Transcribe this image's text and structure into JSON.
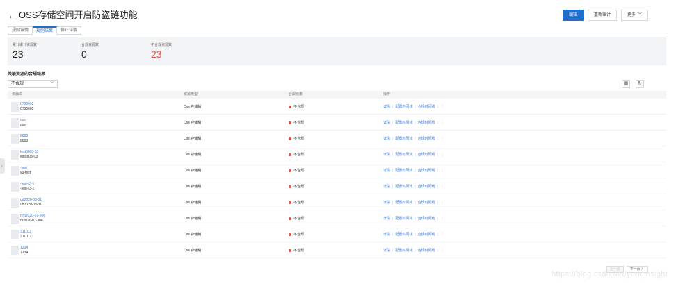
{
  "header": {
    "back_glyph": "←",
    "title": "OSS存储空间开启防盗链功能"
  },
  "actions": {
    "primary": "编辑",
    "recheck": "重新审计",
    "more": "更多",
    "more_chevron": "﹀"
  },
  "tabs": [
    {
      "label": "规则详情"
    },
    {
      "label": "规则结果"
    },
    {
      "label": "修正详情"
    }
  ],
  "summary": {
    "items": [
      {
        "label": "累计审计资源数",
        "value": "23"
      },
      {
        "label": "合规资源数",
        "value": "0"
      },
      {
        "label": "不合规资源数",
        "value": "23"
      }
    ],
    "noncompliant_color": "#e0504a"
  },
  "section_title": "关联资源的合规结果",
  "filter": {
    "value": "不合规",
    "arrow": "﹀"
  },
  "toolbar": {
    "grid_icon": "▦",
    "refresh_icon": "↻"
  },
  "table": {
    "headers": [
      "资源ID",
      "资源类型",
      "合规结果",
      "操作"
    ],
    "rows": [
      {
        "link": "0730603",
        "sub": "0730603",
        "type": "Oss 存储桶",
        "status": "不合规"
      },
      {
        "link": "oss-",
        "sub": "oss-",
        "type": "Oss 存储桶",
        "status": "不合规"
      },
      {
        "link": "8888",
        "sub": "8888",
        "type": "Oss 存储桶",
        "status": "不合规"
      },
      {
        "link": "test0803-03",
        "sub": "est0803-03",
        "type": "Oss 存储桶",
        "status": "不合规"
      },
      {
        "link": "-test",
        "sub": "yu-test",
        "type": "Oss 存储桶",
        "status": "不合规"
      },
      {
        "link": "-test-r3-1",
        "sub": "-test-r3-1",
        "type": "Oss 存储桶",
        "status": "不合规"
      },
      {
        "link": "ud2020-08-31",
        "sub": "ud2020-08-31",
        "type": "Oss 存储桶",
        "status": "不合规"
      },
      {
        "link": "rrrd2020-07-306",
        "sub": "rd2020-07-306",
        "type": "Oss 存储桶",
        "status": "不合规"
      },
      {
        "link": "311012",
        "sub": "311012",
        "type": "Oss 存储桶",
        "status": "不合规"
      },
      {
        "link": "1234",
        "sub": "1234",
        "type": "Oss 存储桶",
        "status": "不合规"
      }
    ],
    "ops": [
      "详情",
      "配置时间线",
      "合规时间线"
    ],
    "op_sep": "|",
    "op_more": "⋮"
  },
  "pager": {
    "prev": "上一页",
    "next": "下一页 〉"
  },
  "watermark": "https://blog.csdn.net/yunqinsight",
  "colors": {
    "primary": "#1f6fcf",
    "link": "#3a7bd5",
    "danger": "#e0504a"
  }
}
